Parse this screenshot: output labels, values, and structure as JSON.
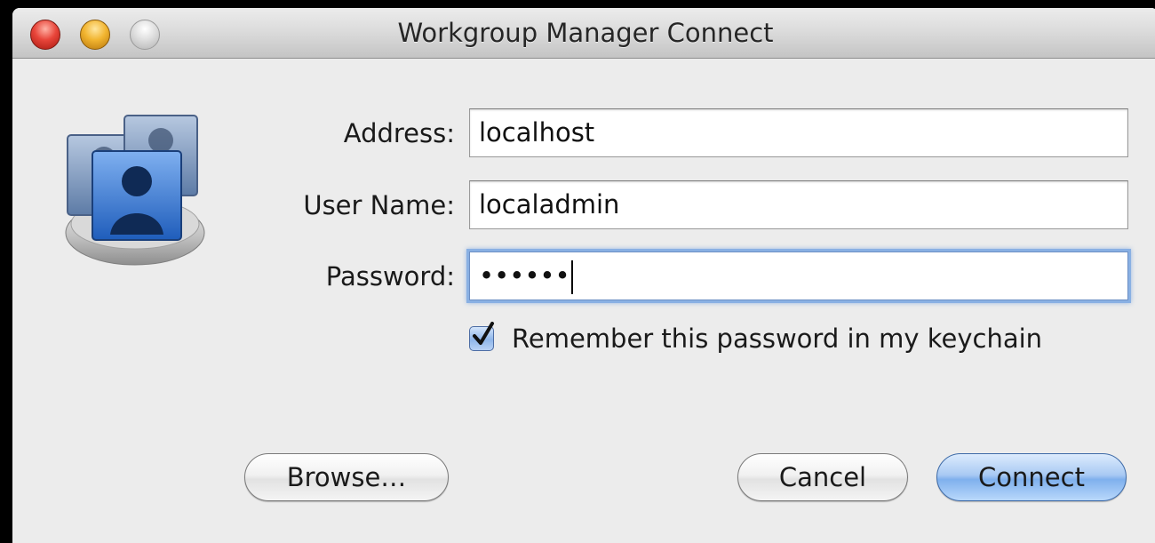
{
  "window": {
    "title": "Workgroup Manager Connect",
    "traffic_lights": {
      "close_color": "#e8453a",
      "minimize_color": "#f2b530",
      "zoom_color": "#dadada"
    },
    "icon": "workgroup-manager-users-icon"
  },
  "form": {
    "address": {
      "label": "Address:",
      "value": "localhost"
    },
    "user_name": {
      "label": "User Name:",
      "value": "localadmin"
    },
    "password": {
      "label": "Password:",
      "value": "••••••",
      "focused": true
    },
    "remember_keychain": {
      "label": "Remember this password in my keychain",
      "checked": true
    }
  },
  "buttons": {
    "browse": "Browse…",
    "cancel": "Cancel",
    "connect": "Connect"
  },
  "colors": {
    "focus_ring": "#89b0e3",
    "default_button": "#7fb0ed",
    "window_background": "#ececec"
  }
}
